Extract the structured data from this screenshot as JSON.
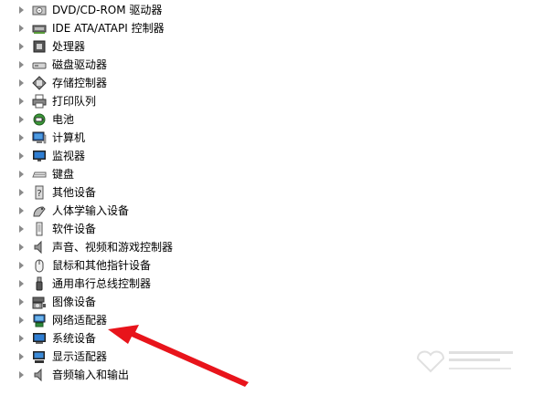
{
  "tree": {
    "items": [
      {
        "label": "DVD/CD-ROM 驱动器",
        "icon": "dvd-drive-icon"
      },
      {
        "label": "IDE ATA/ATAPI 控制器",
        "icon": "ide-controller-icon"
      },
      {
        "label": "处理器",
        "icon": "processor-icon"
      },
      {
        "label": "磁盘驱动器",
        "icon": "disk-drive-icon"
      },
      {
        "label": "存储控制器",
        "icon": "storage-controller-icon"
      },
      {
        "label": "打印队列",
        "icon": "printer-icon"
      },
      {
        "label": "电池",
        "icon": "battery-icon"
      },
      {
        "label": "计算机",
        "icon": "computer-icon"
      },
      {
        "label": "监视器",
        "icon": "monitor-icon"
      },
      {
        "label": "键盘",
        "icon": "keyboard-icon"
      },
      {
        "label": "其他设备",
        "icon": "other-devices-icon"
      },
      {
        "label": "人体学输入设备",
        "icon": "hid-icon"
      },
      {
        "label": "软件设备",
        "icon": "software-device-icon"
      },
      {
        "label": "声音、视频和游戏控制器",
        "icon": "speaker-icon"
      },
      {
        "label": "鼠标和其他指针设备",
        "icon": "mouse-icon"
      },
      {
        "label": "通用串行总线控制器",
        "icon": "usb-icon"
      },
      {
        "label": "图像设备",
        "icon": "camera-icon"
      },
      {
        "label": "网络适配器",
        "icon": "network-adapter-icon"
      },
      {
        "label": "系统设备",
        "icon": "system-device-icon"
      },
      {
        "label": "显示适配器",
        "icon": "display-adapter-icon"
      },
      {
        "label": "音频输入和输出",
        "icon": "audio-io-icon"
      }
    ]
  },
  "annotation": {
    "arrow_color": "#e8141b",
    "points_to": "网络适配器"
  },
  "watermark": {
    "logo": "baidu-jingyan-watermark"
  }
}
